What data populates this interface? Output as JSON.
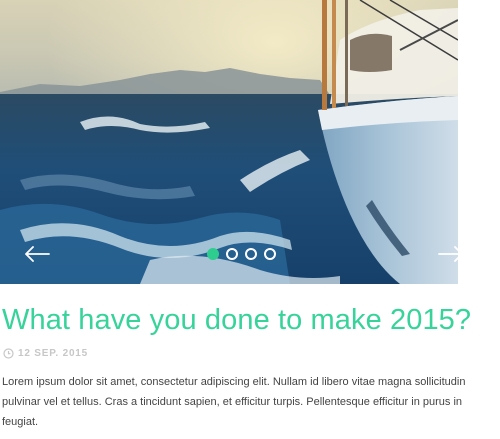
{
  "slider": {
    "slide_count": 4,
    "active_index": 0,
    "prev_icon": "arrow-left-icon",
    "next_icon": "arrow-right-icon"
  },
  "post": {
    "title": "What have you done to make 2015?",
    "date_icon": "clock-icon",
    "date": "12 SEP. 2015",
    "excerpt": "Lorem ipsum dolor sit amet, consectetur adipiscing elit. Nullam id libero vitae magna sollicitudin pulvinar vel et tellus. Cras a tincidunt sapien, et efficitur turpis. Pellentesque efficitur in purus in feugiat."
  },
  "colors": {
    "accent": "#37d39a",
    "meta_text": "#c7c7c7",
    "body_text": "#444444"
  }
}
